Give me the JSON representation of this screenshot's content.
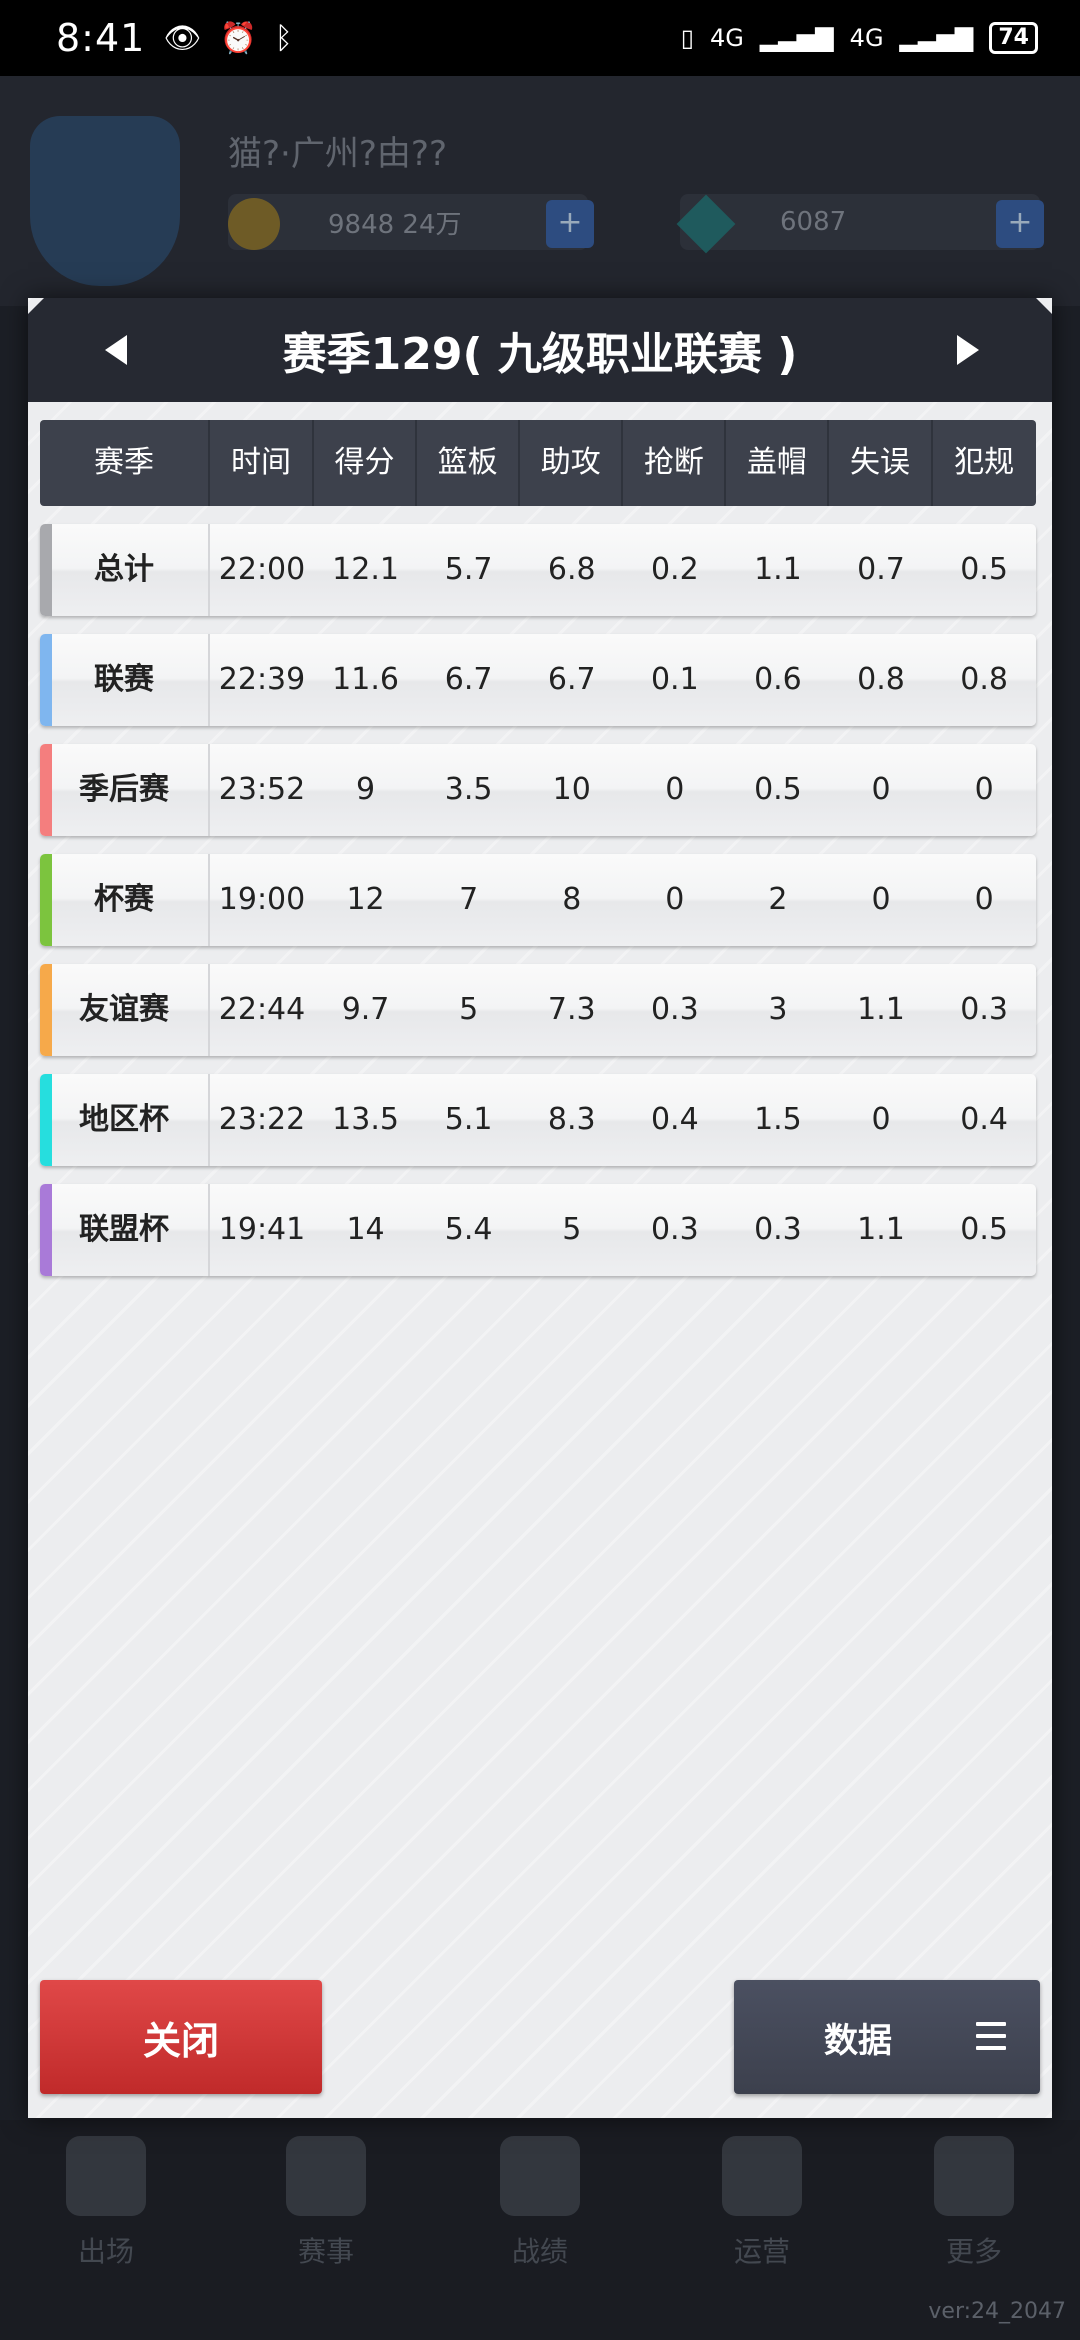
{
  "status_bar": {
    "time": "8:41",
    "battery": "74",
    "network": "4G"
  },
  "background": {
    "team_name": "猫?·广州?由??",
    "coins": "9848 24万",
    "gems": "6087",
    "tabs": [
      "出场",
      "赛事",
      "战绩",
      "运营",
      "更多"
    ],
    "version": "ver:24_2047"
  },
  "modal": {
    "title": "赛季129( 九级职业联赛 )",
    "headers": [
      "赛季",
      "时间",
      "得分",
      "篮板",
      "助攻",
      "抢断",
      "盖帽",
      "失误",
      "犯规"
    ],
    "rows": [
      {
        "label": "总计",
        "color": "#a8a9ad",
        "values": [
          "22:00",
          "12.1",
          "5.7",
          "6.8",
          "0.2",
          "1.1",
          "0.7",
          "0.5"
        ]
      },
      {
        "label": "联赛",
        "color": "#7fb6ef",
        "values": [
          "22:39",
          "11.6",
          "6.7",
          "6.7",
          "0.1",
          "0.6",
          "0.8",
          "0.8"
        ]
      },
      {
        "label": "季后赛",
        "color": "#f47e7e",
        "values": [
          "23:52",
          "9",
          "3.5",
          "10",
          "0",
          "0.5",
          "0",
          "0"
        ]
      },
      {
        "label": "杯赛",
        "color": "#7cc43e",
        "values": [
          "19:00",
          "12",
          "7",
          "8",
          "0",
          "2",
          "0",
          "0"
        ]
      },
      {
        "label": "友谊赛",
        "color": "#f6a94a",
        "values": [
          "22:44",
          "9.7",
          "5",
          "7.3",
          "0.3",
          "3",
          "1.1",
          "0.3"
        ]
      },
      {
        "label": "地区杯",
        "color": "#26dede",
        "values": [
          "23:22",
          "13.5",
          "5.1",
          "8.3",
          "0.4",
          "1.5",
          "0",
          "0.4"
        ]
      },
      {
        "label": "联盟杯",
        "color": "#a97ad8",
        "values": [
          "19:41",
          "14",
          "5.4",
          "5",
          "0.3",
          "0.3",
          "1.1",
          "0.5"
        ]
      }
    ],
    "close_label": "关闭",
    "data_label": "数据"
  }
}
